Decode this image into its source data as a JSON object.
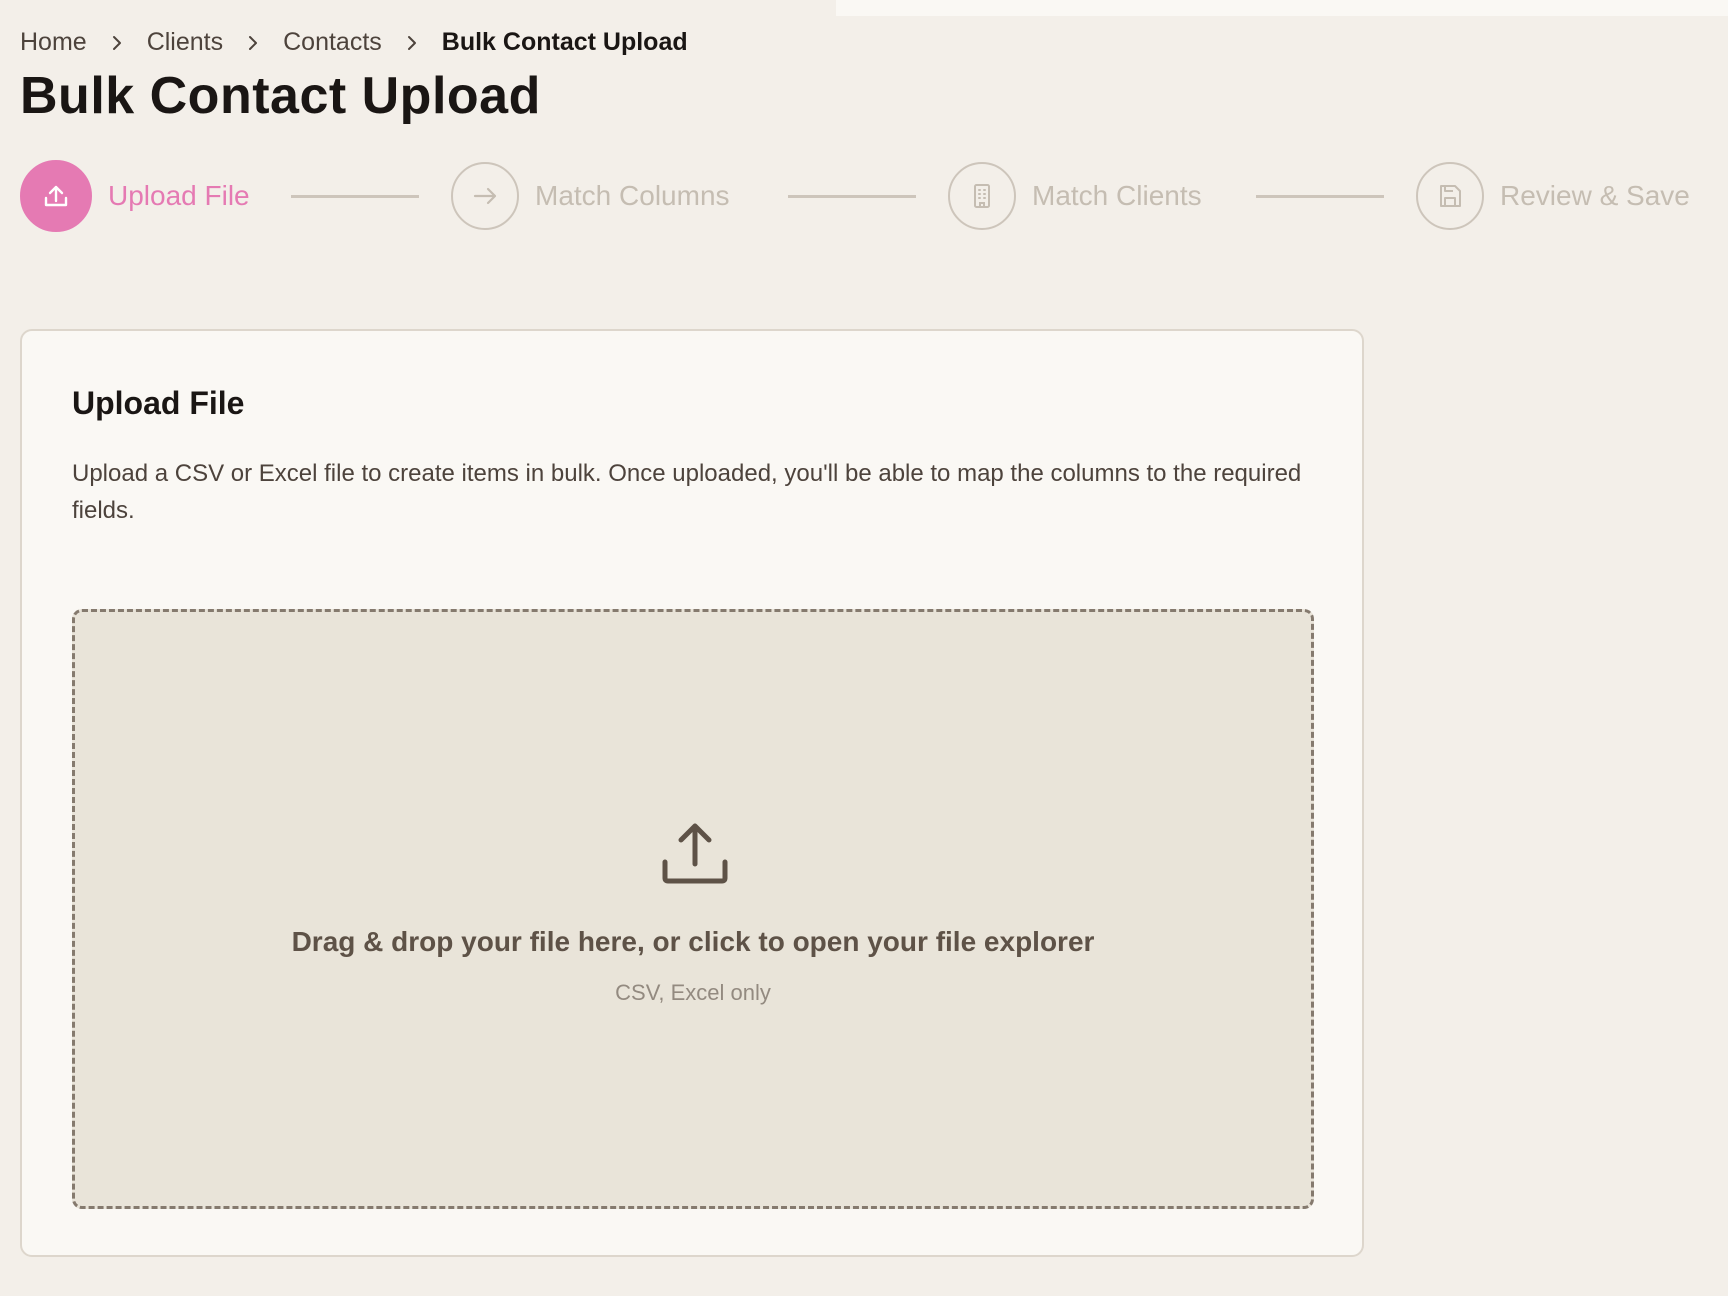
{
  "breadcrumb": {
    "items": [
      "Home",
      "Clients",
      "Contacts"
    ],
    "current": "Bulk Contact Upload"
  },
  "page": {
    "title": "Bulk Contact Upload"
  },
  "stepper": {
    "active_index": 0,
    "steps": [
      {
        "label": "Upload File",
        "icon": "upload-icon"
      },
      {
        "label": "Match Columns",
        "icon": "arrow-right-icon"
      },
      {
        "label": "Match Clients",
        "icon": "building-icon"
      },
      {
        "label": "Review & Save",
        "icon": "save-icon"
      }
    ]
  },
  "card": {
    "title": "Upload File",
    "description": "Upload a CSV or Excel file to create items in bulk. Once uploaded, you'll be able to map the columns to the required fields.",
    "dropzone": {
      "icon": "upload-icon",
      "text": "Drag & drop your file here, or click to open your file explorer",
      "subtext": "CSV, Excel only"
    }
  },
  "colors": {
    "accent": "#e57ab3",
    "background": "#f3efe9",
    "card": "#faf8f4",
    "dropzone": "#e9e4d9",
    "inactive": "#c5bdb2"
  }
}
